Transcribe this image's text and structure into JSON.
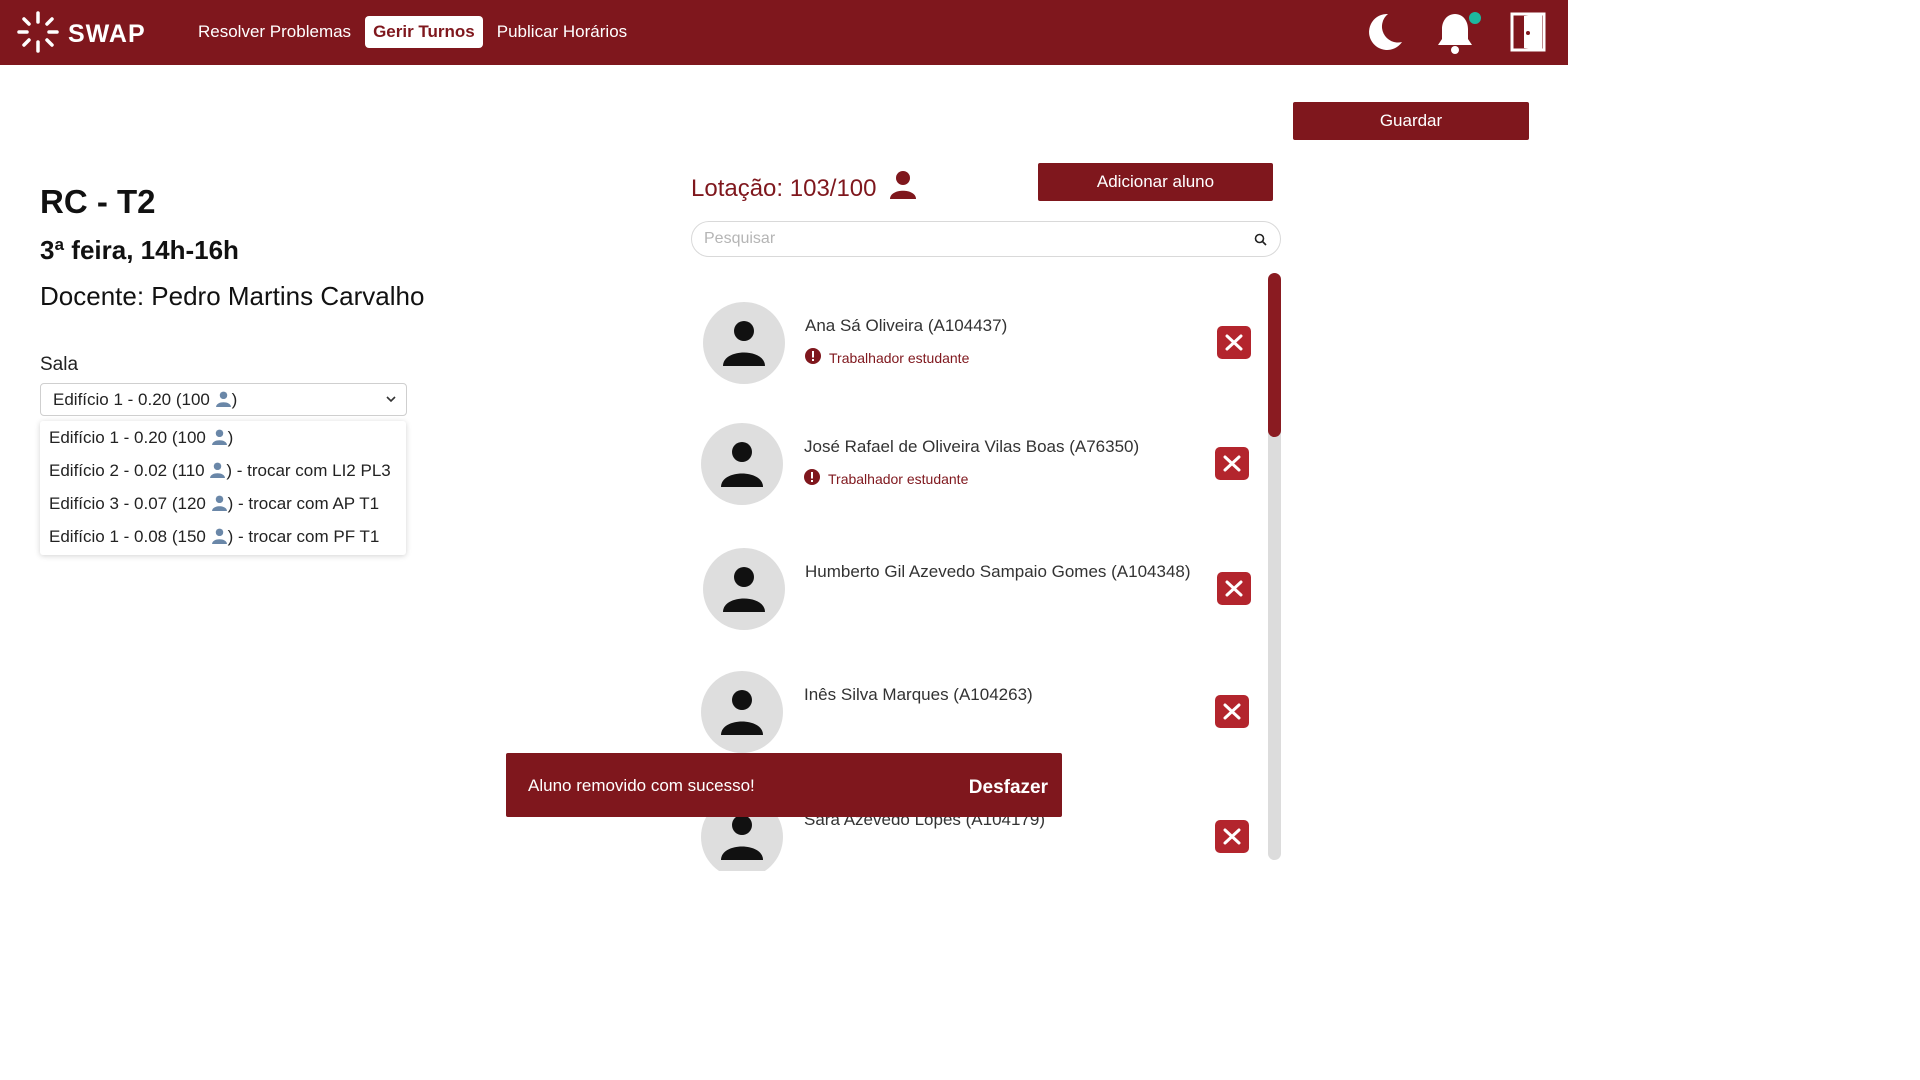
{
  "app": {
    "name": "SWAP"
  },
  "nav": [
    {
      "label": "Resolver Problemas"
    },
    {
      "label": "Gerir Turnos"
    },
    {
      "label": "Publicar Horários"
    }
  ],
  "actions": {
    "save_label": "Guardar",
    "add_student_label": "Adicionar aluno"
  },
  "shift": {
    "title": "RC - T2",
    "schedule": "3ª feira, 14h-16h",
    "teacher": "Docente: Pedro Martins Carvalho"
  },
  "room": {
    "label": "Sala",
    "selected_text": "Edifício 1 - 0.20 (100",
    "options": [
      {
        "text": "Edifício 1 - 0.20 (100",
        "suffix": ")"
      },
      {
        "text": "Edifício 2 - 0.02 (110",
        "suffix": ") - trocar com LI2 PL3"
      },
      {
        "text": "Edifício 3 - 0.07 (120",
        "suffix": ") - trocar com AP T1"
      },
      {
        "text": "Edifício 1 - 0.08 (150",
        "suffix": ") - trocar com PF T1"
      }
    ]
  },
  "capacity": {
    "text": "Lotação: 103/100"
  },
  "search": {
    "placeholder": "Pesquisar"
  },
  "students": [
    {
      "name": "Ana Sá Oliveira (A104437)",
      "tag": "Trabalhador estudante"
    },
    {
      "name": "José Rafael de Oliveira Vilas Boas (A76350)",
      "tag": "Trabalhador estudante"
    },
    {
      "name": "Humberto Gil Azevedo Sampaio Gomes (A104348)",
      "tag": ""
    },
    {
      "name": "Inês Silva Marques (A104263)",
      "tag": ""
    },
    {
      "name": "Sara Azevedo Lopes (A104179)",
      "tag": ""
    }
  ],
  "toast": {
    "message": "Aluno removido com sucesso!",
    "undo_label": "Desfazer"
  },
  "colors": {
    "brand": "#7f171d",
    "remove": "#b3252d",
    "notification": "#1db89f"
  },
  "icons": [
    "swap-logo-icon",
    "moon-icon",
    "bell-icon",
    "logout-door-icon",
    "person-icon",
    "search-icon",
    "chevron-down-icon",
    "alert-icon",
    "close-icon"
  ]
}
